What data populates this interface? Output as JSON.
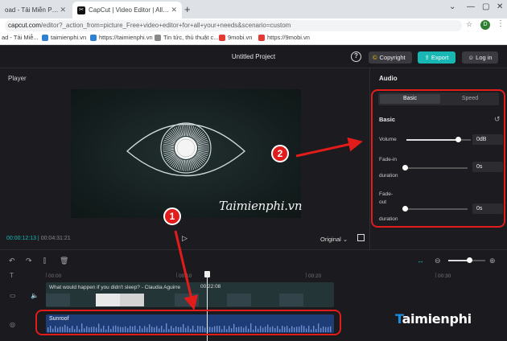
{
  "browser": {
    "tabs": [
      {
        "label": "oad - Tải Miễn Phí VN - Ph",
        "active": false
      },
      {
        "label": "CapCut | Video Editor | All-In-On",
        "active": true
      }
    ],
    "favicon_text": "✂",
    "url_host": "capcut.com",
    "url_path": "/editor?_action_from=picture_Free+video+editor+for+all+your+needs&scenario=custom",
    "profile_initial": "D",
    "bookmarks": [
      "ad - Tải Miễ...",
      "taimienphi.vn",
      "https://taimienphi.vn",
      "Tin tức, thủ thuật c...",
      "9mobi.vn",
      "https://9mobi.vn"
    ]
  },
  "header": {
    "project_name": "Untitled Project",
    "help_glyph": "?",
    "copyright_label": "Copyright",
    "export_label": "Export",
    "login_label": "Log in"
  },
  "player": {
    "label": "Player",
    "watermark": "Taimienphi.vn",
    "current_time": "00:00:12:13",
    "total_time": "00:04:31:21",
    "ratio_label": "Original"
  },
  "audio_panel": {
    "title": "Audio",
    "tabs": [
      "Basic",
      "Speed"
    ],
    "section_title": "Basic",
    "volume": {
      "label": "Volume",
      "value": "0dB",
      "level": 0.8
    },
    "fade_in": {
      "label_line1": "Fade-in",
      "label_line2": "duration",
      "value": "0s",
      "level": 0
    },
    "fade_out": {
      "label_line1": "Fade-",
      "label_line2": "out",
      "label_line3": "duration",
      "value": "0s",
      "level": 0
    }
  },
  "timeline": {
    "ticks": [
      "00:00",
      "00:10",
      "00:20",
      "00:30"
    ],
    "video_clip_title": "What would happen if you didn't sleep? - Claudia Aguirre",
    "playhead_time": "00:22:08",
    "audio_clip_title": "Sunroof"
  },
  "annotations": {
    "badge1": "1",
    "badge2": "2",
    "color": "#e21b1b"
  },
  "logo": {
    "mark": "T",
    "text": "aimienphi"
  },
  "colors": {
    "accent": "#18b7b4",
    "audio_clip": "#1e3d77",
    "video_clip": "#233537"
  }
}
